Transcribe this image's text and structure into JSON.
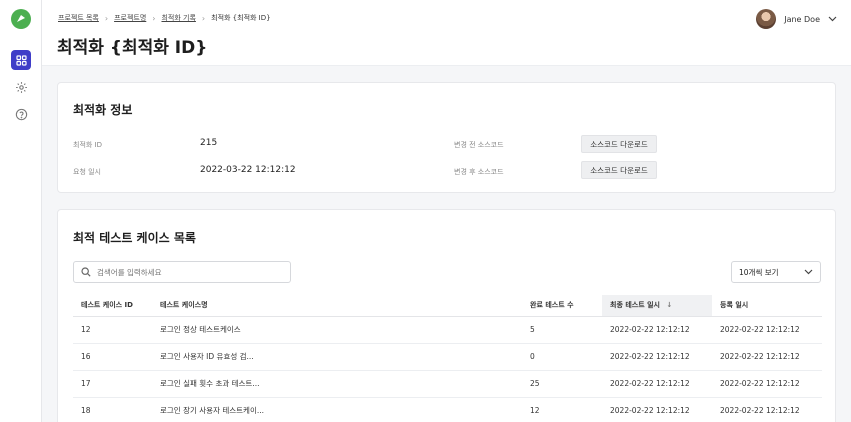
{
  "breadcrumb": {
    "items": [
      "프로젝트 목록",
      "프로젝트명",
      "최적화 기록"
    ],
    "current": "최적화 {최적화 ID}"
  },
  "page_title": "최적화 {최적화 ID}",
  "user": {
    "name": "Jane Doe"
  },
  "rail": {
    "icons": [
      "logo-icon",
      "dashboard-icon",
      "settings-icon",
      "help-icon"
    ],
    "accent": "#3f3dc8",
    "logo_color": "#4caf50"
  },
  "info": {
    "title": "최적화 정보",
    "id_label": "최적화 ID",
    "id_value": "215",
    "date_label": "요청 일시",
    "date_value": "2022-03-22 12:12:12",
    "before_label": "변경 전 소스코드",
    "after_label": "변경 후 소스코드",
    "download_label": "소스코드 다운로드"
  },
  "cases": {
    "title": "최적 테스트 케이스 목록",
    "search_placeholder": "검색어를 입력하세요",
    "page_size": "10개씩 보기",
    "columns": [
      "테스트 케이스 ID",
      "테스트 케이스명",
      "완료 테스트 수",
      "최종 테스트 일시",
      "등록 일시"
    ],
    "sort_indicator": "↓",
    "rows": [
      [
        "12",
        "로그인 정상 테스트케이스",
        "5",
        "2022-02-22 12:12:12",
        "2022-02-22 12:12:12"
      ],
      [
        "16",
        "로그인 사용자 ID 유효성 검...",
        "0",
        "2022-02-22 12:12:12",
        "2022-02-22 12:12:12"
      ],
      [
        "17",
        "로그인 실패 횟수 초과 테스트...",
        "25",
        "2022-02-22 12:12:12",
        "2022-02-22 12:12:12"
      ],
      [
        "18",
        "로그인 장기 사용자 테스트케이...",
        "12",
        "2022-02-22 12:12:12",
        "2022-02-22 12:12:12"
      ]
    ]
  }
}
